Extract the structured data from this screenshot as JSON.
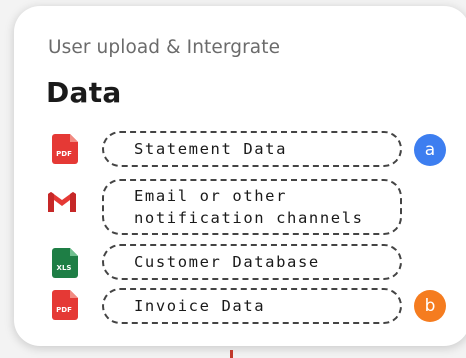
{
  "card": {
    "subtitle": "User upload & Intergrate",
    "title": "Data"
  },
  "sources": [
    {
      "label_lines": [
        "Statement Data"
      ],
      "icon": "pdf-file-icon",
      "icon_text": "PDF",
      "icon_color": "#e53935",
      "badge": "a",
      "badge_color": "#3d7ef0"
    },
    {
      "label_lines": [
        "Email or other",
        "notification channels"
      ],
      "icon": "gmail-icon",
      "icon_text": "",
      "icon_color": "#e53935",
      "badge": "",
      "badge_color": ""
    },
    {
      "label_lines": [
        "Customer Database"
      ],
      "icon": "xls-file-icon",
      "icon_text": "XLS",
      "icon_color": "#1e7e45",
      "badge": "",
      "badge_color": ""
    },
    {
      "label_lines": [
        "Invoice Data"
      ],
      "icon": "pdf-file-icon",
      "icon_text": "PDF",
      "icon_color": "#e53935",
      "badge": "b",
      "badge_color": "#f57c1f"
    }
  ]
}
